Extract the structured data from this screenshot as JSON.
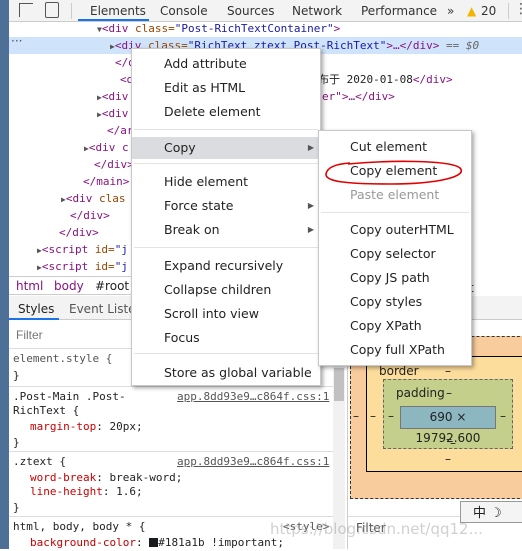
{
  "toolbar": {
    "tabs": [
      "Elements",
      "Console",
      "Sources",
      "Network",
      "Performance"
    ],
    "active_tab": "Elements",
    "more": "»",
    "warnings": "20",
    "colors": {
      "accent": "#1a73e8",
      "warning": "#f4b400"
    }
  },
  "tree": [
    {
      "tri": "▼",
      "tag": "<div ",
      "attr": "class=",
      "val": "\"Post-RichTextContainer\"",
      "rest": ">"
    },
    {
      "tri": "▶",
      "tag": "<div ",
      "attr": "class=",
      "val": "\"RichText ztext Post-RichText\"",
      "rest": ">…</div>",
      "extra": " == $0"
    },
    {
      "tag": "</di"
    },
    {
      "tag": "<div",
      "cn": "布于 2020-01-08",
      "rest": "</div>"
    },
    {
      "tri": "▶",
      "tag": "<div",
      "rest2": "er\">…</div>"
    },
    {
      "tri": "▶",
      "tag": "<div"
    },
    {
      "tag": "</art"
    },
    {
      "tri": "▶",
      "tag": "<div c"
    },
    {
      "tag": "</div>"
    },
    {
      "tag": "</main>"
    },
    {
      "tri": "▶",
      "tag": "<div ",
      "attr": "clas"
    },
    {
      "tag": "</div>"
    },
    {
      "tag": "</div>"
    },
    {
      "tri": "▶",
      "tag": "<script ",
      "attr": "id=",
      "val": "\"j"
    },
    {
      "tri": "▶",
      "tag": "<script ",
      "attr": "id=",
      "val": "\"j"
    }
  ],
  "breadcrumbs": [
    "html",
    "body",
    "#root"
  ],
  "subtabs": [
    "Styles",
    "Event Listen"
  ],
  "filter_placeholder": "Filter",
  "styles": {
    "r1_sel": "element.style {",
    "close": "}",
    "r2_sel1": ".Post-Main .Post-",
    "r2_sel2": "RichText {",
    "r2_src": "app.8dd93e9…c864f.css:1",
    "r2_p": "margin-top",
    "r2_v": ": 20px;",
    "r3_sel": ".ztext {",
    "r3_src": "app.8dd93e9…c864f.css:1",
    "r3_p1": "word-break",
    "r3_v1": ": break-word;",
    "r3_p2": "line-height",
    "r3_v2": ": 1.6;",
    "r4_sel": "html, body, body * {",
    "r4_src": "<style>",
    "r4_p": "background-color",
    "r4_v": "#181a1b !important;",
    "swatch": "#181a1b"
  },
  "boxmodel": {
    "border": "border",
    "padding": "padding",
    "dash": "–",
    "content": "690 × 19792.600",
    "filter": "Filter",
    "partial_tab": "t"
  },
  "context_menu": {
    "items": [
      "Add attribute",
      "Edit as HTML",
      "Delete element",
      "Copy",
      "Hide element",
      "Force state",
      "Break on",
      "Expand recursively",
      "Collapse children",
      "Scroll into view",
      "Focus",
      "Store as global variable"
    ],
    "highlighted": "Copy"
  },
  "copy_submenu": {
    "items": [
      "Cut element",
      "Copy element",
      "Paste element",
      "Copy outerHTML",
      "Copy selector",
      "Copy JS path",
      "Copy styles",
      "Copy XPath",
      "Copy full XPath"
    ],
    "disabled": [
      "Paste element"
    ],
    "circled": "Copy element",
    "annotation_color": "#e00000"
  },
  "watermark": "https://blog.csdn.net/qq12..."
}
